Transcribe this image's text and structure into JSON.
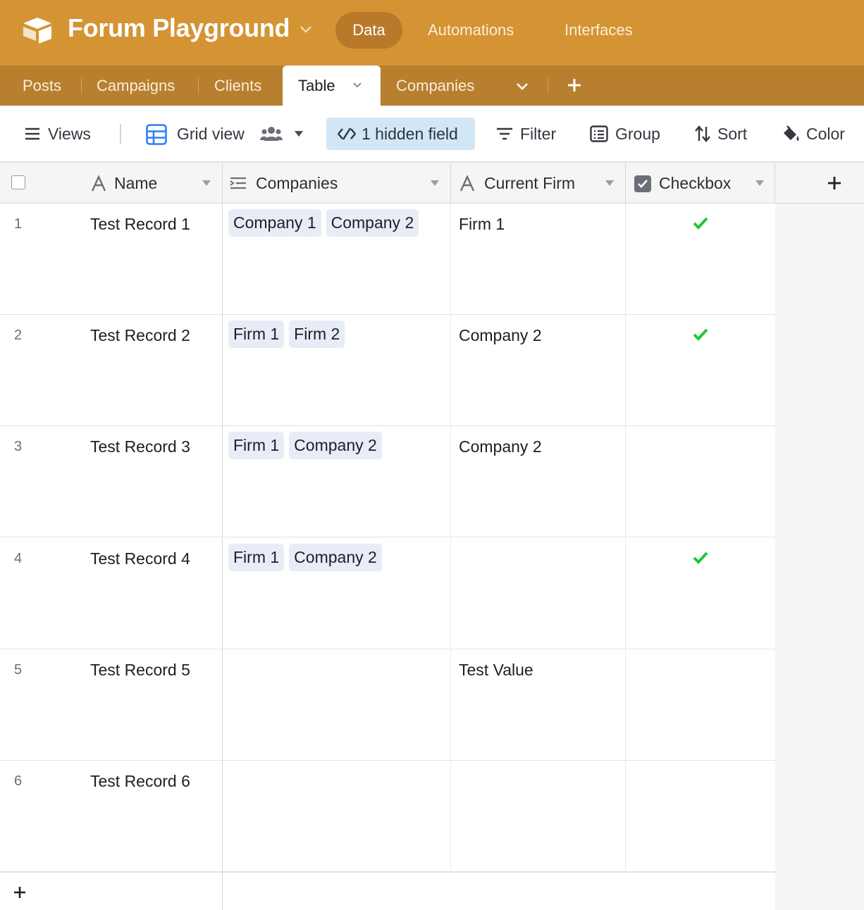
{
  "app": {
    "base_name": "Forum Playground",
    "nav": [
      "Data",
      "Automations",
      "Interfaces"
    ],
    "brand_color": "#d49434"
  },
  "tabs": {
    "items": [
      "Posts",
      "Campaigns",
      "Clients",
      "Table",
      "Companies"
    ],
    "active": "Table"
  },
  "toolbar": {
    "views": "Views",
    "view_name": "Grid view",
    "hidden_fields": "1 hidden field",
    "filter": "Filter",
    "group": "Group",
    "sort": "Sort",
    "color": "Color"
  },
  "grid": {
    "columns": [
      {
        "name": "Name",
        "icon": "text-field-icon"
      },
      {
        "name": "Companies",
        "icon": "linked-records-icon"
      },
      {
        "name": "Current Firm",
        "icon": "text-field-icon"
      },
      {
        "name": "Checkbox",
        "icon": "checkbox-field-icon"
      }
    ],
    "rows": [
      {
        "num": "1",
        "name": "Test Record 1",
        "companies": [
          "Company 1",
          "Company 2"
        ],
        "current_firm": "Firm 1",
        "checked": true
      },
      {
        "num": "2",
        "name": "Test Record 2",
        "companies": [
          "Firm 1",
          "Firm 2"
        ],
        "current_firm": "Company 2",
        "checked": true
      },
      {
        "num": "3",
        "name": "Test Record 3",
        "companies": [
          "Firm 1",
          "Company 2"
        ],
        "current_firm": "Company 2",
        "checked": false
      },
      {
        "num": "4",
        "name": "Test Record 4",
        "companies": [
          "Firm 1",
          "Company 2"
        ],
        "current_firm": "",
        "checked": true
      },
      {
        "num": "5",
        "name": "Test Record 5",
        "companies": [],
        "current_firm": "Test Value",
        "checked": false
      },
      {
        "num": "6",
        "name": "Test Record 6",
        "companies": [],
        "current_firm": "",
        "checked": false
      }
    ]
  }
}
